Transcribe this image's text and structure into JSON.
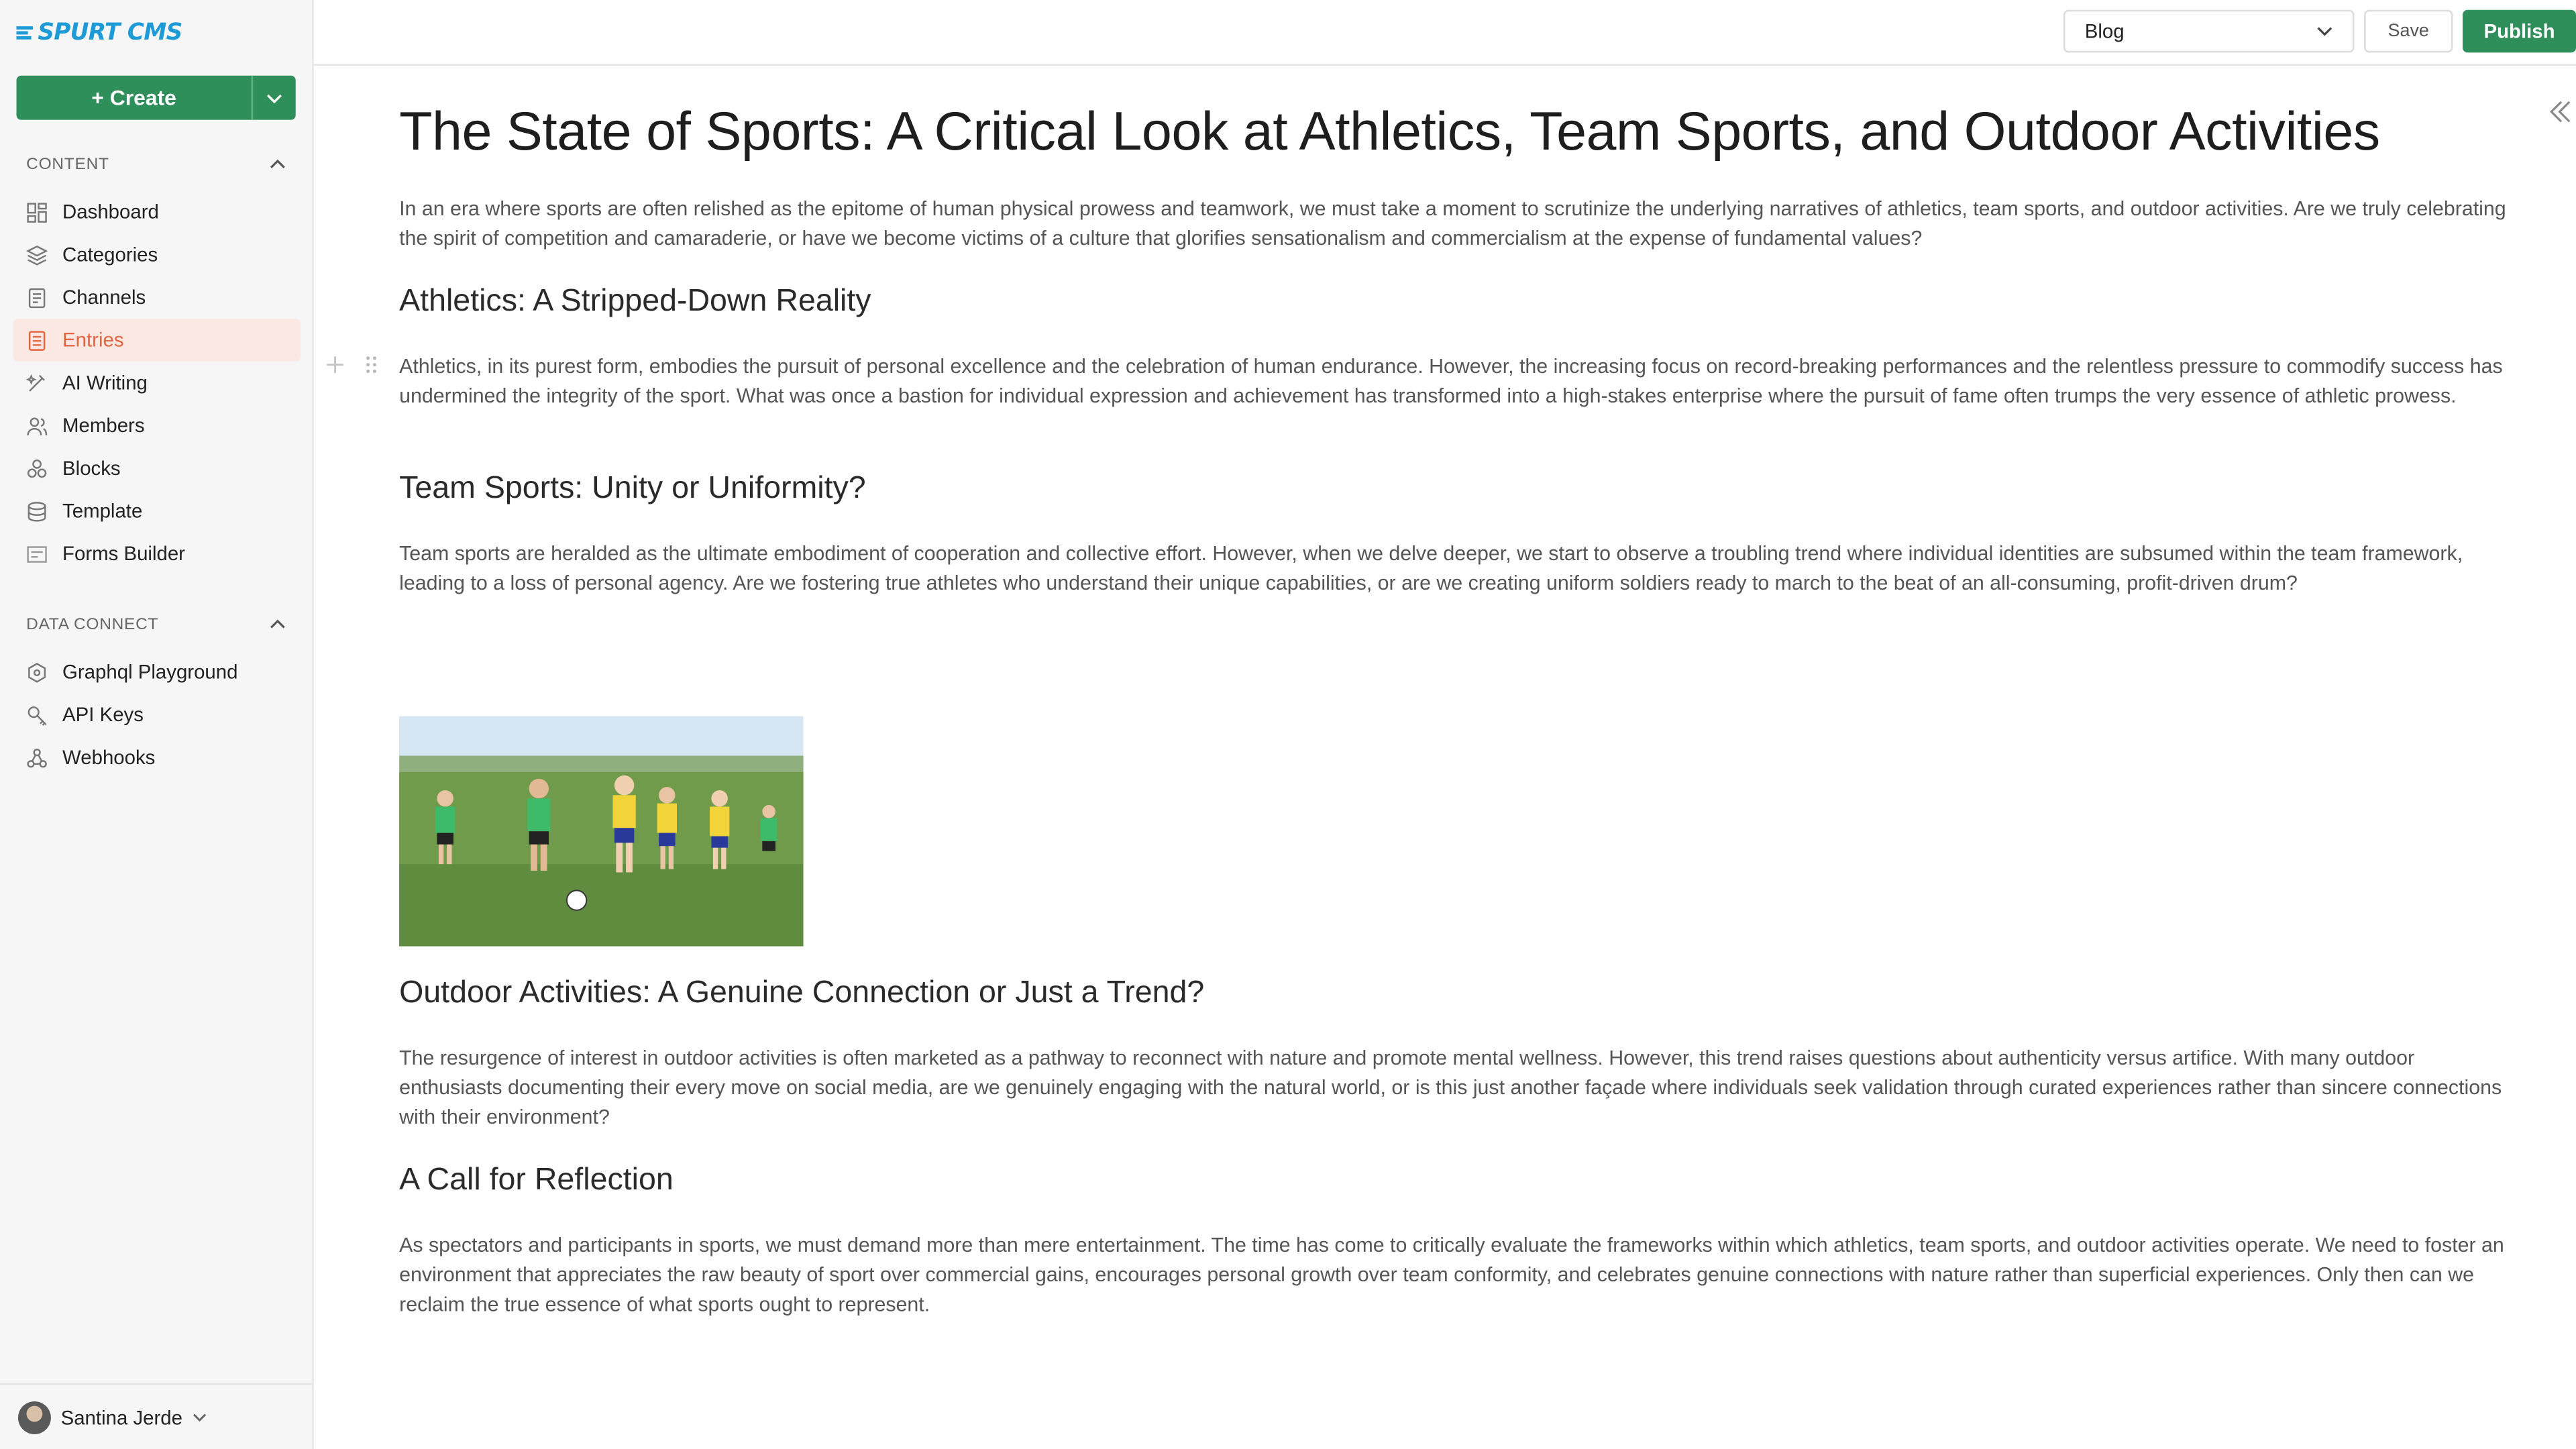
{
  "app": {
    "logo_text": "SPURT CMS",
    "brand_color": "#1e9ad6",
    "accent_green": "#2f8f5b",
    "active_color": "#e3653f"
  },
  "sidebar": {
    "create_label": "+ Create",
    "content_section": {
      "label": "CONTENT",
      "items": [
        {
          "label": "Dashboard",
          "icon": "dashboard-icon"
        },
        {
          "label": "Categories",
          "icon": "categories-icon"
        },
        {
          "label": "Channels",
          "icon": "channels-icon"
        },
        {
          "label": "Entries",
          "icon": "entries-icon",
          "active": true
        },
        {
          "label": "AI Writing",
          "icon": "ai-writing-icon"
        },
        {
          "label": "Members",
          "icon": "members-icon"
        },
        {
          "label": "Blocks",
          "icon": "blocks-icon"
        },
        {
          "label": "Template",
          "icon": "template-icon"
        },
        {
          "label": "Forms Builder",
          "icon": "forms-builder-icon"
        }
      ]
    },
    "data_section": {
      "label": "DATA CONNECT",
      "items": [
        {
          "label": "Graphql Playground",
          "icon": "graphql-icon"
        },
        {
          "label": "API Keys",
          "icon": "key-icon"
        },
        {
          "label": "Webhooks",
          "icon": "webhook-icon"
        }
      ]
    },
    "user": {
      "name": "Santina Jerde"
    }
  },
  "topbar": {
    "channel_select": "Blog",
    "save_label": "Save",
    "publish_label": "Publish"
  },
  "article": {
    "title": "The State of Sports: A Critical Look at Athletics, Team Sports, and Outdoor Activities",
    "intro": "In an era where sports are often relished as the epitome of human physical prowess and teamwork, we must take a moment to scrutinize the underlying narratives of athletics, team sports, and outdoor activities. Are we truly celebrating the spirit of competition and camaraderie, or have we become victims of a culture that glorifies sensationalism and commercialism at the expense of fundamental values?",
    "h_athletics": "Athletics: A Stripped-Down Reality",
    "p_athletics": "Athletics, in its purest form, embodies the pursuit of personal excellence and the celebration of human endurance. However, the increasing focus on record-breaking performances and the relentless pressure to commodify success has undermined the integrity of the sport. What was once a bastion for individual expression and achievement has transformed into a high-stakes enterprise where the pursuit of fame often trumps the very essence of athletic prowess.",
    "h_team": "Team Sports: Unity or Uniformity?",
    "p_team": "Team sports are heralded as the ultimate embodiment of cooperation and collective effort. However, when we delve deeper, we start to observe a troubling trend where individual identities are subsumed within the team framework, leading to a loss of personal agency. Are we fostering true athletes who understand their unique capabilities, or are we creating uniform soldiers ready to march to the beat of an all-consuming, profit-driven drum?",
    "h_outdoor": "Outdoor Activities: A Genuine Connection or Just a Trend?",
    "p_outdoor": "The resurgence of interest in outdoor activities is often marketed as a pathway to reconnect with nature and promote mental wellness. However, this trend raises questions about authenticity versus artifice. With many outdoor enthusiasts documenting their every move on social media, are we genuinely engaging with the natural world, or is this just another façade where individuals seek validation through curated experiences rather than sincere connections with their environment?",
    "h_call": "A Call for Reflection",
    "p_call": "As spectators and participants in sports, we must demand more than mere entertainment. The time has come to critically evaluate the frameworks within which athletics, team sports, and outdoor activities operate. We need to foster an environment that appreciates the raw beauty of sport over commercial gains, encourages personal growth over team conformity, and celebrates genuine connections with nature rather than superficial experiences. Only then can we reclaim the true essence of what sports ought to represent."
  }
}
